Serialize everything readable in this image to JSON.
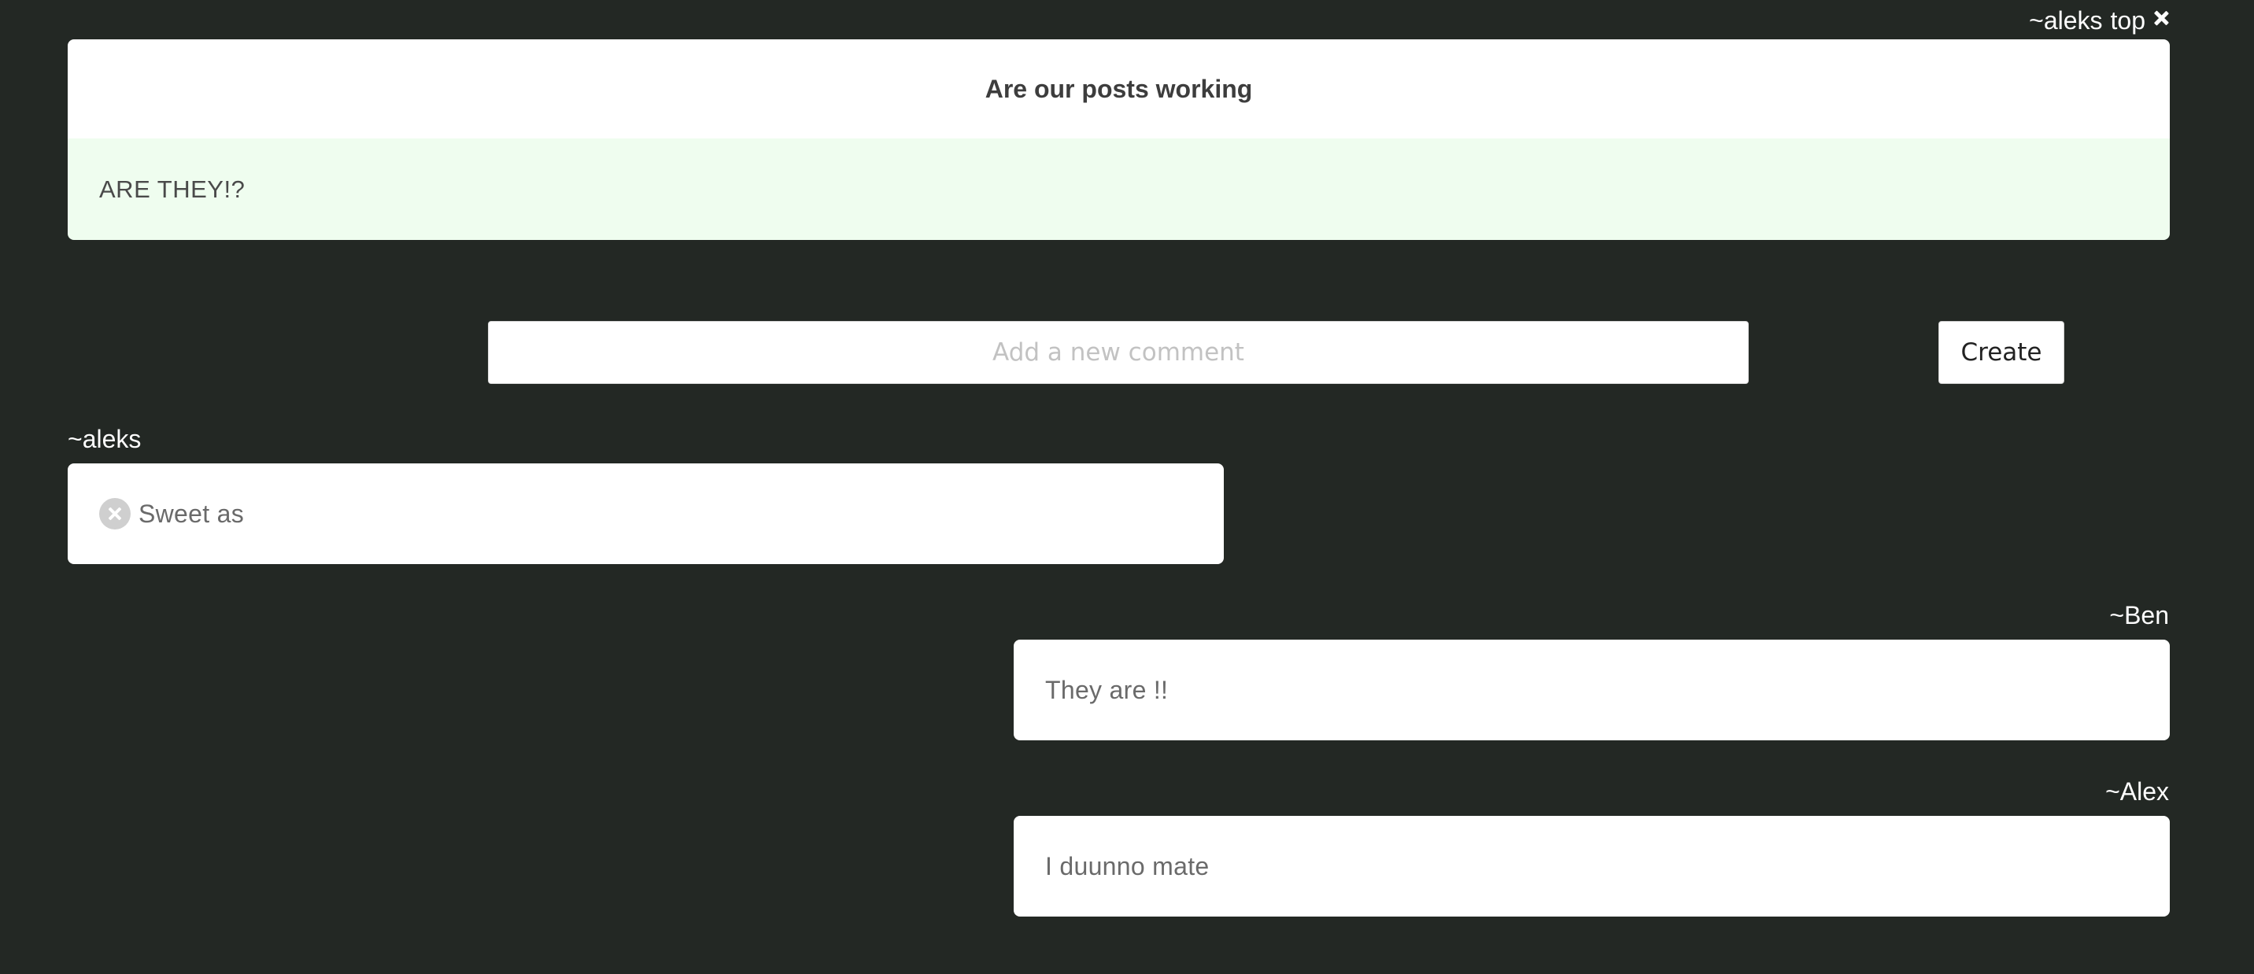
{
  "post": {
    "author": "~aleks",
    "placement": "top",
    "title": "Are our posts working",
    "body": "ARE THEY!?"
  },
  "comment_form": {
    "placeholder": "Add a new comment",
    "value": "",
    "create_label": "Create"
  },
  "comments": [
    {
      "author": "~aleks",
      "text": "Sweet as",
      "align": "left",
      "deletable": true
    },
    {
      "author": "~Ben",
      "text": "They are !!",
      "align": "right",
      "deletable": false
    },
    {
      "author": "~Alex",
      "text": "I duunno mate",
      "align": "right",
      "deletable": false
    }
  ],
  "icons": {
    "post_close": "close-icon",
    "comment_delete": "delete-circle-icon"
  },
  "colors": {
    "background": "#232824",
    "card": "#ffffff",
    "post_body": "#effdef",
    "title_text": "#3d3d3d",
    "comment_text": "#6a6a6a",
    "placeholder": "#c2c2c2"
  }
}
